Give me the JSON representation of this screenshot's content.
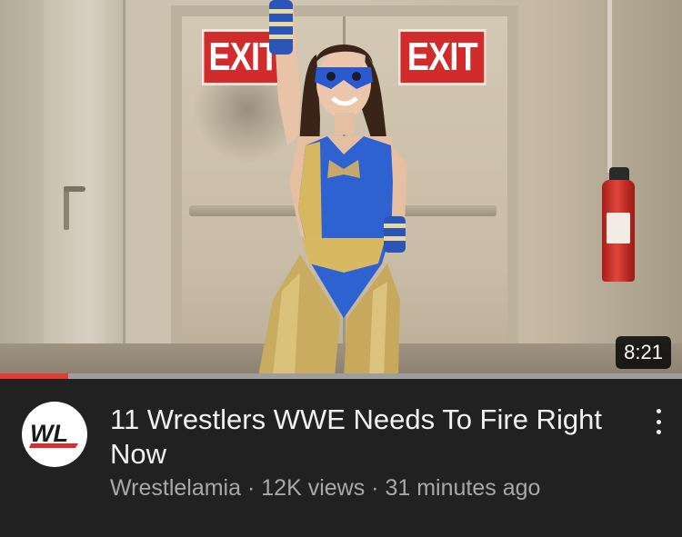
{
  "video": {
    "title": "11 Wrestlers WWE Needs To Fire Right Now",
    "duration": "8:21",
    "progress_fraction": 0.1,
    "thumbnail_signs": [
      "EXIT",
      "EXIT"
    ]
  },
  "channel": {
    "name": "Wrestlelamia",
    "avatar_text": "WL"
  },
  "meta": {
    "views": "12K views",
    "age": "31 minutes ago",
    "separator": "·"
  },
  "icons": {
    "menu": "more-vert-icon"
  },
  "colors": {
    "background": "#212121",
    "progress": "#e53935",
    "title": "#f1f1f1",
    "subtitle": "#a8a8a8",
    "exit_sign": "#d22b2b"
  }
}
